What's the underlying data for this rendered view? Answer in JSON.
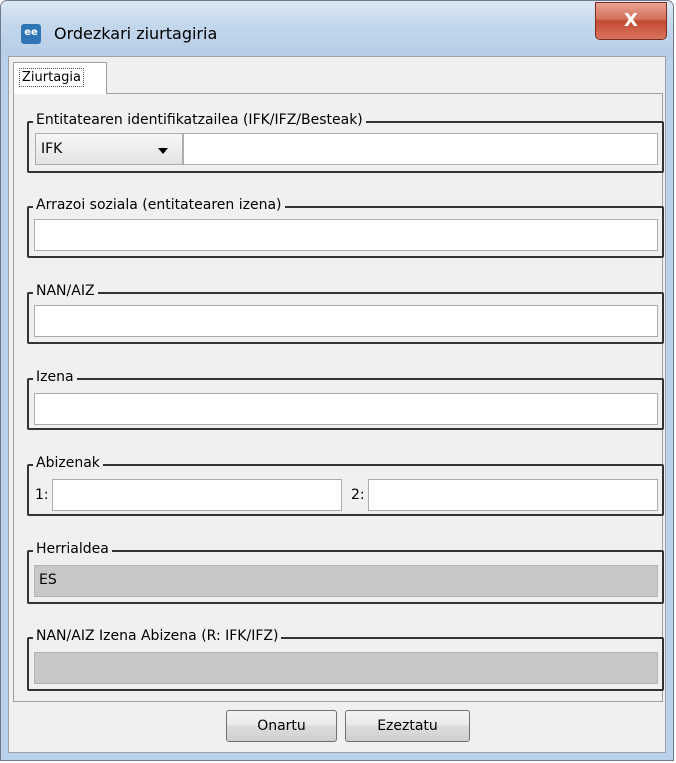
{
  "window": {
    "title": "Ordezkari ziurtagiria",
    "app_icon_text": "ee",
    "close_symbol": "X"
  },
  "tabs": [
    {
      "label": "Ziurtagia",
      "active": true
    }
  ],
  "form": {
    "entity_id": {
      "label": "Entitatearen identifikatzailea (IFK/IFZ/Besteak)",
      "type_selected": "IFK",
      "value": ""
    },
    "legal_name": {
      "label": "Arrazoi soziala (entitatearen izena)",
      "value": ""
    },
    "nan_aiz": {
      "label": "NAN/AIZ",
      "value": ""
    },
    "name": {
      "label": "Izena",
      "value": ""
    },
    "surnames": {
      "label": "Abizenak",
      "first_label": "1:",
      "first_value": "",
      "second_label": "2:",
      "second_value": ""
    },
    "country": {
      "label": "Herrialdea",
      "value": "ES"
    },
    "full_name": {
      "label": "NAN/AIZ Izena Abizena (R: IFK/IFZ)",
      "value": ""
    }
  },
  "buttons": {
    "ok": "Onartu",
    "cancel": "Ezeztatu"
  },
  "colors": {
    "close_button": "#c44a33",
    "disabled_field": "#c8c8c8"
  }
}
